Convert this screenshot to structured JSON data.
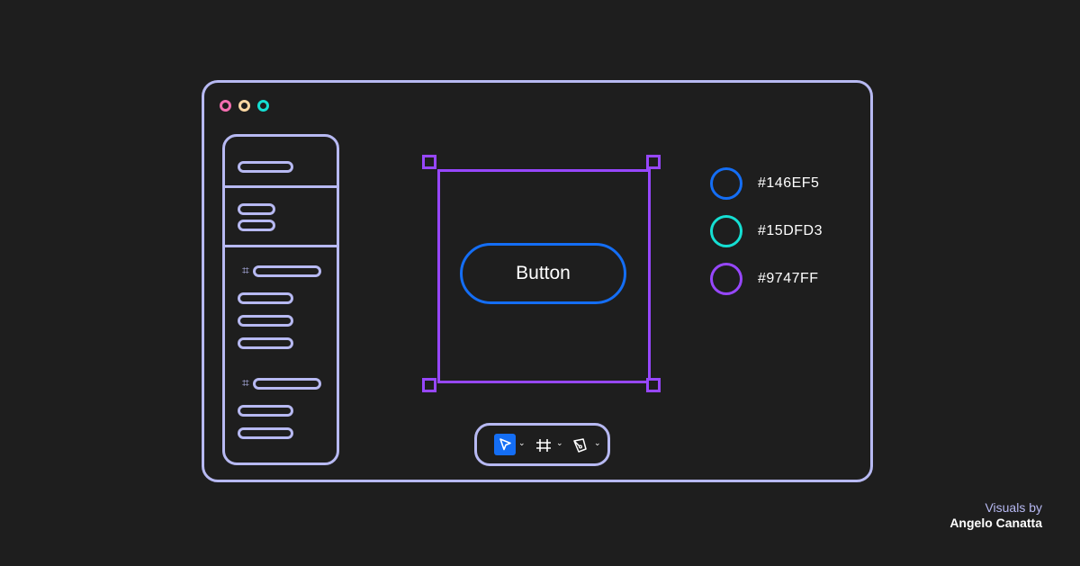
{
  "colors": {
    "background": "#1e1e1e",
    "outline": "#b7b9f2",
    "frame": "#9747ff",
    "button": "#146ef5",
    "dot_pink": "#f46eb0",
    "dot_yellow": "#fbd7a2",
    "dot_teal": "#15dfd3",
    "tool_active": "#146ef5"
  },
  "window": {
    "controls": [
      "pink-dot",
      "yellow-dot",
      "teal-dot"
    ]
  },
  "sidebar": {
    "section_icons": [
      "hash-icon",
      "hash-icon"
    ],
    "hash_glyph": "⌗"
  },
  "canvas": {
    "button_label": "Button"
  },
  "swatches": [
    {
      "label": "#146EF5",
      "color": "#146ef5"
    },
    {
      "label": "#15DFD3",
      "color": "#15dfd3"
    },
    {
      "label": "#9747FF",
      "color": "#9747ff"
    }
  ],
  "toolbar": {
    "tools": [
      "cursor-icon",
      "frame-icon",
      "pen-icon"
    ],
    "active_tool": "cursor-icon",
    "caret_glyph": "⌄"
  },
  "credit": {
    "line1": "Visuals by",
    "line2": "Angelo Canatta"
  }
}
